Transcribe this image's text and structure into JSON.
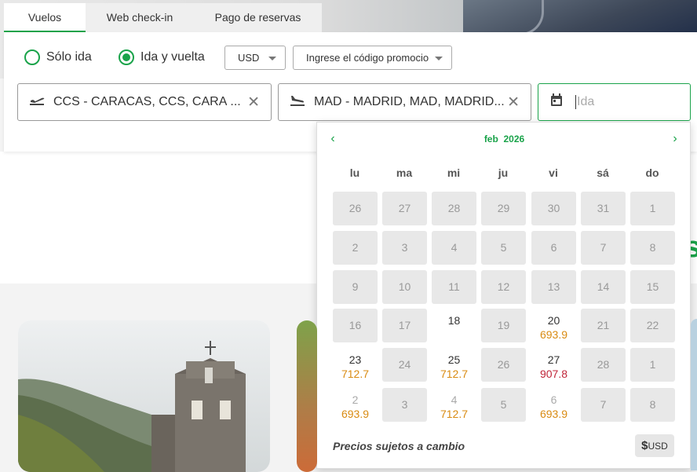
{
  "tabs": [
    "Vuelos",
    "Web check-in",
    "Pago de reservas"
  ],
  "trip_type": {
    "one_way": "Sólo ida",
    "round_trip": "Ida y vuelta",
    "selected": "round_trip"
  },
  "currency": {
    "value": "USD"
  },
  "promo": {
    "placeholder": "Ingrese el código promocio"
  },
  "origin": {
    "value": "CCS - CARACAS, CCS, CARA"
  },
  "destination": {
    "value": "MAD - MADRID, MAD, MADRID..."
  },
  "departure": {
    "placeholder": "Ida"
  },
  "calendar": {
    "month": "feb",
    "year": "2026",
    "weekdays": [
      "lu",
      "ma",
      "mi",
      "ju",
      "vi",
      "sá",
      "do"
    ],
    "weeks": [
      [
        {
          "d": "26",
          "s": "dis"
        },
        {
          "d": "27",
          "s": "dis"
        },
        {
          "d": "28",
          "s": "dis"
        },
        {
          "d": "29",
          "s": "dis"
        },
        {
          "d": "30",
          "s": "dis"
        },
        {
          "d": "31",
          "s": "dis"
        },
        {
          "d": "1",
          "s": "dis"
        }
      ],
      [
        {
          "d": "2",
          "s": "dis"
        },
        {
          "d": "3",
          "s": "dis"
        },
        {
          "d": "4",
          "s": "dis"
        },
        {
          "d": "5",
          "s": "dis"
        },
        {
          "d": "6",
          "s": "dis"
        },
        {
          "d": "7",
          "s": "dis"
        },
        {
          "d": "8",
          "s": "dis"
        }
      ],
      [
        {
          "d": "9",
          "s": "dis"
        },
        {
          "d": "10",
          "s": "dis"
        },
        {
          "d": "11",
          "s": "dis"
        },
        {
          "d": "12",
          "s": "dis"
        },
        {
          "d": "13",
          "s": "dis"
        },
        {
          "d": "14",
          "s": "dis"
        },
        {
          "d": "15",
          "s": "dis"
        }
      ],
      [
        {
          "d": "16",
          "s": "dis"
        },
        {
          "d": "17",
          "s": "dis"
        },
        {
          "d": "18",
          "s": "avail"
        },
        {
          "d": "19",
          "s": "dis"
        },
        {
          "d": "20",
          "s": "avail",
          "p": "693.9",
          "c": "orange"
        },
        {
          "d": "21",
          "s": "dis"
        },
        {
          "d": "22",
          "s": "dis"
        }
      ],
      [
        {
          "d": "23",
          "s": "avail",
          "p": "712.7",
          "c": "orange"
        },
        {
          "d": "24",
          "s": "dis"
        },
        {
          "d": "25",
          "s": "avail",
          "p": "712.7",
          "c": "orange"
        },
        {
          "d": "26",
          "s": "dis"
        },
        {
          "d": "27",
          "s": "avail",
          "p": "907.8",
          "c": "red"
        },
        {
          "d": "28",
          "s": "dis"
        },
        {
          "d": "1",
          "s": "dis"
        }
      ],
      [
        {
          "d": "2",
          "s": "faded",
          "p": "693.9",
          "c": "orange"
        },
        {
          "d": "3",
          "s": "dis"
        },
        {
          "d": "4",
          "s": "faded",
          "p": "712.7",
          "c": "orange"
        },
        {
          "d": "5",
          "s": "dis"
        },
        {
          "d": "6",
          "s": "faded",
          "p": "693.9",
          "c": "orange"
        },
        {
          "d": "7",
          "s": "dis"
        },
        {
          "d": "8",
          "s": "dis"
        }
      ]
    ],
    "footer_note": "Precios sujetos a cambio",
    "currency_button": "USD",
    "currency_symbol": "$"
  },
  "colors": {
    "accent": "#1aa34a",
    "price_normal": "#d98b12",
    "price_high": "#c0263a"
  }
}
